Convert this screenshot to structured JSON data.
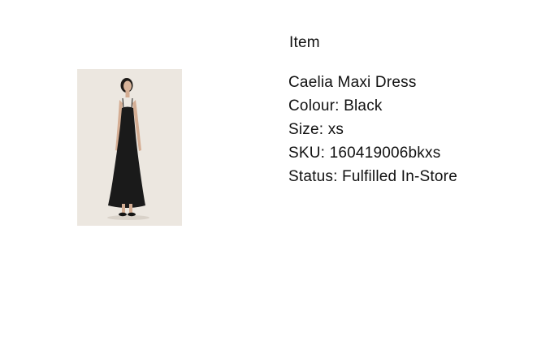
{
  "section": {
    "heading": "Item"
  },
  "item": {
    "image_alt": "Caelia Maxi Dress",
    "name": "Caelia Maxi Dress",
    "colour": "Colour: Black",
    "size": "Size: xs",
    "sku": "SKU: 160419006bkxs",
    "status": "Status: Fulfilled In-Store"
  },
  "colors": {
    "text": "#111111",
    "image_background": "#ece7e0",
    "dress": "#1a1a1a"
  }
}
